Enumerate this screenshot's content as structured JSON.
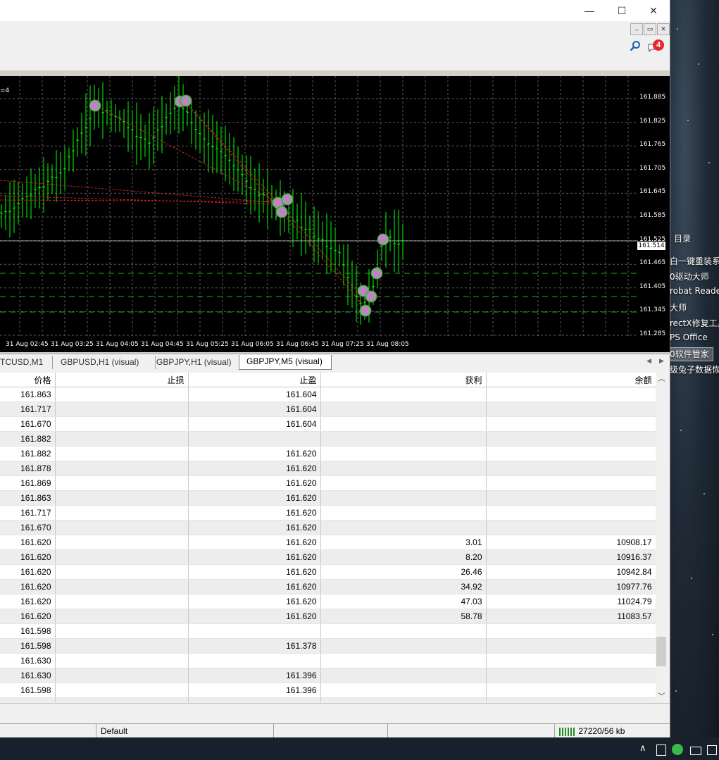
{
  "window": {
    "minimize": "—",
    "maximize": "☐",
    "close": "✕",
    "mdi_minimize": "–",
    "mdi_restore": "▭",
    "mdi_close": "✕"
  },
  "toolbar": {
    "notification_count": "4"
  },
  "chart": {
    "indicator_text": "=4",
    "current_price": "161.514",
    "price_axis": [
      "161.885",
      "161.825",
      "161.765",
      "161.705",
      "161.645",
      "161.585",
      "161.525",
      "161.465",
      "161.405",
      "161.345",
      "161.285"
    ],
    "time_axis": [
      "31 Aug 02:45",
      "31 Aug 03:25",
      "31 Aug 04:05",
      "31 Aug 04:45",
      "31 Aug 05:25",
      "31 Aug 06:05",
      "31 Aug 06:45",
      "31 Aug 07:25",
      "31 Aug 08:05"
    ],
    "colors": {
      "background": "#000000",
      "candle": "#00ff00",
      "grid": "#5a5a5a",
      "trade_line": "#cc2222",
      "order_line": "#22aa22"
    }
  },
  "chart_tabs": [
    {
      "label": "TCUSD,M1"
    },
    {
      "label": "GBPUSD,H1 (visual)"
    },
    {
      "label": "GBPJPY,H1 (visual)"
    },
    {
      "label": "GBPJPY,M5 (visual)",
      "active": true
    }
  ],
  "table": {
    "columns": [
      "价格",
      "止损",
      "止盈",
      "获利",
      "余额"
    ],
    "rows": [
      [
        "161.863",
        "",
        "161.604",
        "",
        ""
      ],
      [
        "161.717",
        "",
        "161.604",
        "",
        ""
      ],
      [
        "161.670",
        "",
        "161.604",
        "",
        ""
      ],
      [
        "161.882",
        "",
        "",
        "",
        ""
      ],
      [
        "161.882",
        "",
        "161.620",
        "",
        ""
      ],
      [
        "161.878",
        "",
        "161.620",
        "",
        ""
      ],
      [
        "161.869",
        "",
        "161.620",
        "",
        ""
      ],
      [
        "161.863",
        "",
        "161.620",
        "",
        ""
      ],
      [
        "161.717",
        "",
        "161.620",
        "",
        ""
      ],
      [
        "161.670",
        "",
        "161.620",
        "",
        ""
      ],
      [
        "161.620",
        "",
        "161.620",
        "3.01",
        "10908.17"
      ],
      [
        "161.620",
        "",
        "161.620",
        "8.20",
        "10916.37"
      ],
      [
        "161.620",
        "",
        "161.620",
        "26.46",
        "10942.84"
      ],
      [
        "161.620",
        "",
        "161.620",
        "34.92",
        "10977.76"
      ],
      [
        "161.620",
        "",
        "161.620",
        "47.03",
        "11024.79"
      ],
      [
        "161.620",
        "",
        "161.620",
        "58.78",
        "11083.57"
      ],
      [
        "161.598",
        "",
        "",
        "",
        ""
      ],
      [
        "161.598",
        "",
        "161.378",
        "",
        ""
      ],
      [
        "161.630",
        "",
        "",
        "",
        ""
      ],
      [
        "161.630",
        "",
        "161.396",
        "",
        ""
      ],
      [
        "161.598",
        "",
        "161.396",
        "",
        ""
      ],
      [
        "",
        "",
        "",
        "",
        ""
      ]
    ]
  },
  "statusbar": {
    "profile": "Default",
    "traffic": "27220/56 kb"
  },
  "desktop": {
    "items": [
      "目录",
      "白一键重装系",
      "0驱动大师",
      "robat Reade",
      "大师",
      "rectX修复工具",
      "PS Office",
      "0软件管家",
      "级兔子数据恢"
    ]
  },
  "taskbar": {
    "chevron": "∧"
  }
}
